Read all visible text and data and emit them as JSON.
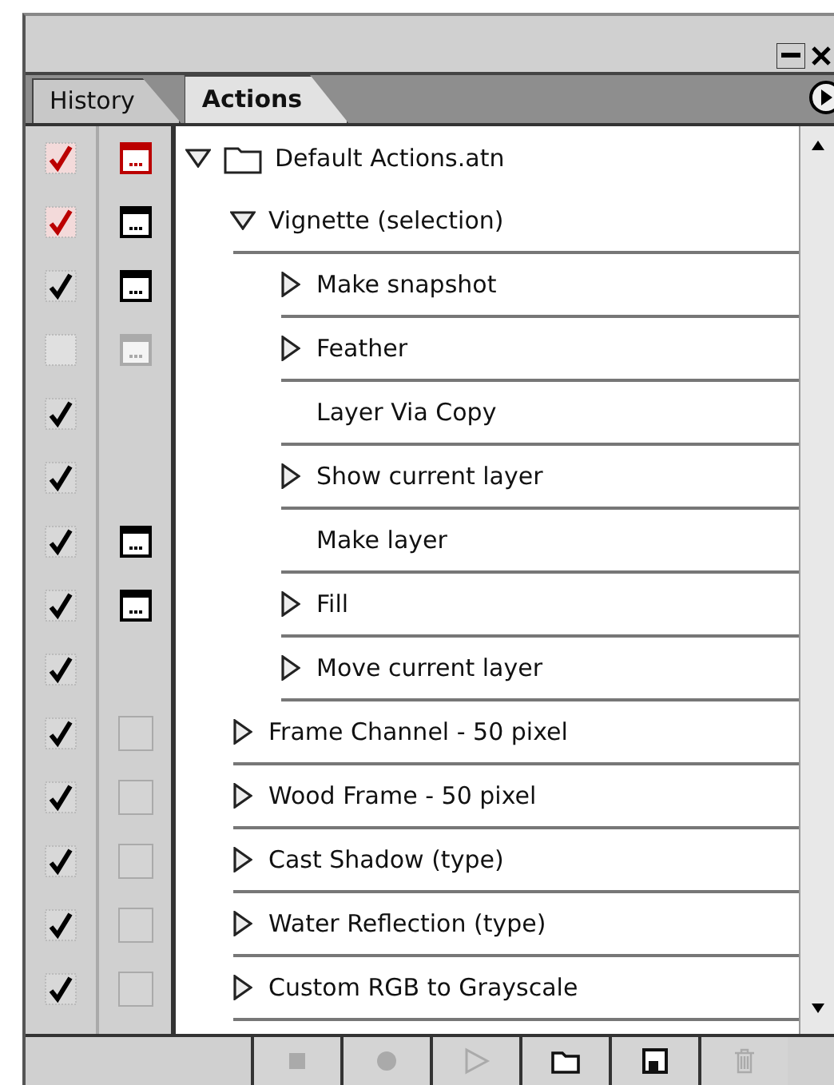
{
  "tabs": [
    {
      "label": "History",
      "selected": false
    },
    {
      "label": "Actions",
      "selected": true
    }
  ],
  "items": [
    {
      "label": "Default Actions.atn",
      "kind": "set",
      "enabled": true,
      "partial": true,
      "has_dialog": true,
      "dialog_on": true,
      "dialog_partial": true,
      "expandable": true,
      "expanded": true,
      "children": [
        {
          "label": "Vignette (selection)",
          "kind": "action",
          "enabled": true,
          "partial": true,
          "has_dialog": true,
          "dialog_on": true,
          "dialog_partial": false,
          "expandable": true,
          "expanded": true,
          "children": [
            {
              "label": "Make snapshot",
              "kind": "command",
              "enabled": true,
              "partial": false,
              "has_dialog": true,
              "dialog_on": true,
              "dialog_partial": false,
              "expandable": true,
              "expanded": false
            },
            {
              "label": "Feather",
              "kind": "command",
              "enabled": false,
              "partial": false,
              "has_dialog": true,
              "dialog_on": false,
              "dialog_partial": false,
              "expandable": true,
              "expanded": false
            },
            {
              "label": "Layer Via Copy",
              "kind": "command",
              "enabled": true,
              "partial": false,
              "has_dialog": false,
              "expandable": false
            },
            {
              "label": "Show current layer",
              "kind": "command",
              "enabled": true,
              "partial": false,
              "has_dialog": false,
              "expandable": true,
              "expanded": false
            },
            {
              "label": "Make layer",
              "kind": "command",
              "enabled": true,
              "partial": false,
              "has_dialog": true,
              "dialog_on": true,
              "dialog_partial": false,
              "expandable": false
            },
            {
              "label": "Fill",
              "kind": "command",
              "enabled": true,
              "partial": false,
              "has_dialog": true,
              "dialog_on": true,
              "dialog_partial": false,
              "expandable": true,
              "expanded": false
            },
            {
              "label": "Move current layer",
              "kind": "command",
              "enabled": true,
              "partial": false,
              "has_dialog": false,
              "expandable": true,
              "expanded": false
            }
          ]
        },
        {
          "label": "Frame Channel - 50 pixel",
          "kind": "action",
          "enabled": true,
          "partial": false,
          "has_dialog": true,
          "dialog_on": false,
          "expandable": true,
          "expanded": false
        },
        {
          "label": "Wood Frame - 50 pixel",
          "kind": "action",
          "enabled": true,
          "partial": false,
          "has_dialog": true,
          "dialog_on": false,
          "expandable": true,
          "expanded": false
        },
        {
          "label": "Cast Shadow (type)",
          "kind": "action",
          "enabled": true,
          "partial": false,
          "has_dialog": true,
          "dialog_on": false,
          "expandable": true,
          "expanded": false
        },
        {
          "label": "Water Reflection (type)",
          "kind": "action",
          "enabled": true,
          "partial": false,
          "has_dialog": true,
          "dialog_on": false,
          "expandable": true,
          "expanded": false
        },
        {
          "label": "Custom RGB to Grayscale",
          "kind": "action",
          "enabled": true,
          "partial": false,
          "has_dialog": true,
          "dialog_on": false,
          "expandable": true,
          "expanded": false
        }
      ]
    }
  ],
  "toolbar": [
    {
      "kind": "stop",
      "disabled": true
    },
    {
      "kind": "record",
      "disabled": true
    },
    {
      "kind": "play",
      "disabled": true
    },
    {
      "kind": "new-set",
      "disabled": false
    },
    {
      "kind": "new-action",
      "disabled": false
    },
    {
      "kind": "delete",
      "disabled": true
    }
  ]
}
